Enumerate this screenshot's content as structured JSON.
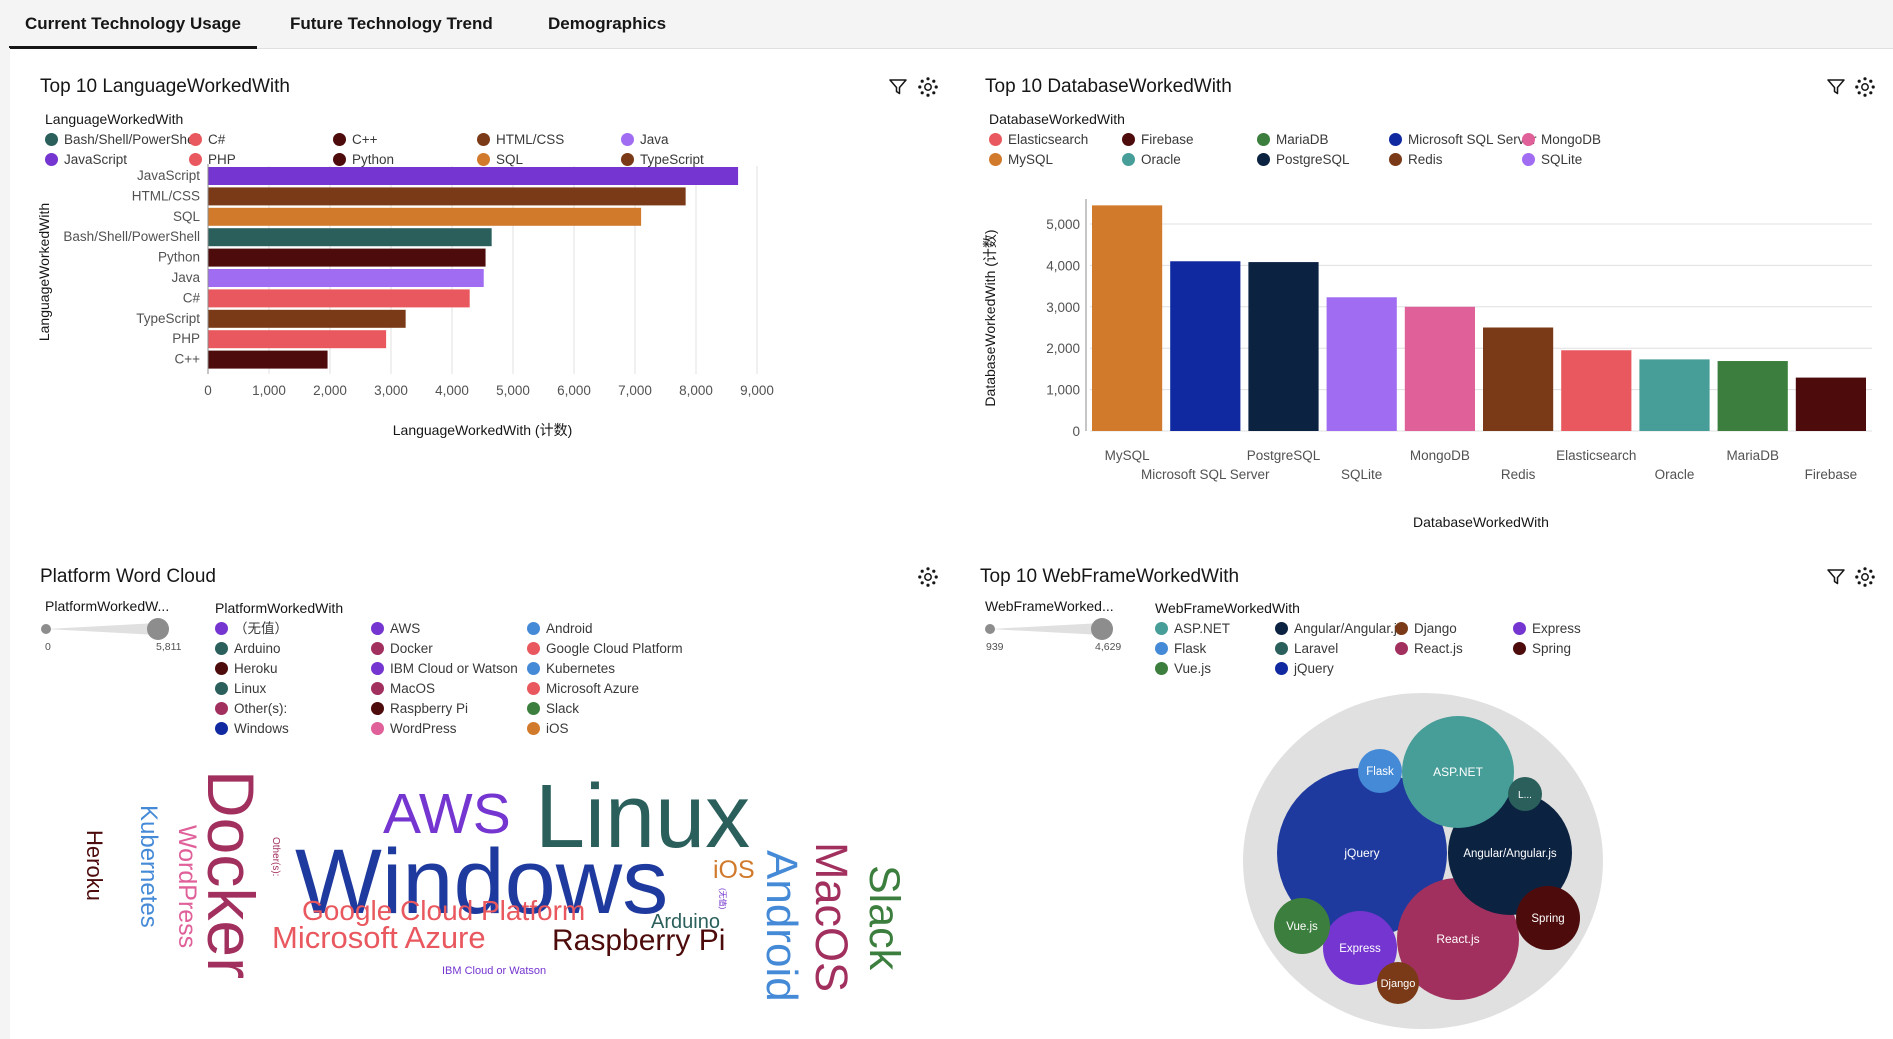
{
  "tabs": [
    {
      "label": "Current Technology Usage",
      "active": true
    },
    {
      "label": "Future Technology Trend",
      "active": false
    },
    {
      "label": "Demographics",
      "active": false
    }
  ],
  "colors": {
    "teal": "#2a5f5b",
    "purple": "#7535d0",
    "brown": "#7b3a17",
    "orange": "#d17a2b",
    "red": "#e8585e",
    "maroon": "#4d0b0b",
    "lilac": "#a06cf2",
    "navy": "#1029a0",
    "darknavy": "#0b2241",
    "pink": "#e0609a",
    "cyan": "#479d98",
    "green": "#3c7e3d",
    "blue": "#458ad7",
    "wine": "#a2305e",
    "sage": "#6a9e8d"
  },
  "language": {
    "title": "Top 10 LanguageWorkedWith",
    "legend_title": "LanguageWorkedWith",
    "legend": [
      {
        "label": "Bash/Shell/PowerShell",
        "color": "#2a5f5b"
      },
      {
        "label": "C#",
        "color": "#e8585e"
      },
      {
        "label": "C++",
        "color": "#4d0b0b"
      },
      {
        "label": "HTML/CSS",
        "color": "#7b3a17"
      },
      {
        "label": "Java",
        "color": "#a06cf2"
      },
      {
        "label": "JavaScript",
        "color": "#7535d0"
      },
      {
        "label": "PHP",
        "color": "#e8585e"
      },
      {
        "label": "Python",
        "color": "#4d0b0b"
      },
      {
        "label": "SQL",
        "color": "#d17a2b"
      },
      {
        "label": "TypeScript",
        "color": "#7b3a17"
      }
    ]
  },
  "database": {
    "title": "Top 10 DatabaseWorkedWith",
    "legend_title": "DatabaseWorkedWith",
    "legend": [
      {
        "label": "Elasticsearch",
        "color": "#e8585e"
      },
      {
        "label": "Firebase",
        "color": "#4d0b0b"
      },
      {
        "label": "MariaDB",
        "color": "#3c7e3d"
      },
      {
        "label": "Microsoft SQL Server",
        "color": "#1029a0"
      },
      {
        "label": "MongoDB",
        "color": "#e0609a"
      },
      {
        "label": "MySQL",
        "color": "#d17a2b"
      },
      {
        "label": "Oracle",
        "color": "#479d98"
      },
      {
        "label": "PostgreSQL",
        "color": "#0b2241"
      },
      {
        "label": "Redis",
        "color": "#7b3a17"
      },
      {
        "label": "SQLite",
        "color": "#a06cf2"
      }
    ]
  },
  "platform": {
    "title": "Platform Word Cloud",
    "slider_label": "PlatformWorkedW...",
    "slider_min": "0",
    "slider_max": "5,811",
    "slider_range": [
      0,
      5811
    ],
    "legend_title": "PlatformWorkedWith",
    "legend": [
      {
        "label": "（无值）",
        "color": "#7535d0"
      },
      {
        "label": "AWS",
        "color": "#7535d0"
      },
      {
        "label": "Android",
        "color": "#458ad7"
      },
      {
        "label": "Arduino",
        "color": "#2a5f5b"
      },
      {
        "label": "Docker",
        "color": "#a2305e"
      },
      {
        "label": "Google Cloud Platform",
        "color": "#e8585e"
      },
      {
        "label": "Heroku",
        "color": "#4d0b0b"
      },
      {
        "label": "IBM Cloud or Watson",
        "color": "#7535d0"
      },
      {
        "label": "Kubernetes",
        "color": "#458ad7"
      },
      {
        "label": "Linux",
        "color": "#2a5f5b"
      },
      {
        "label": "MacOS",
        "color": "#a2305e"
      },
      {
        "label": "Microsoft Azure",
        "color": "#e8585e"
      },
      {
        "label": "Other(s):",
        "color": "#a2305e"
      },
      {
        "label": "Raspberry Pi",
        "color": "#4d0b0b"
      },
      {
        "label": "Slack",
        "color": "#3c7e3d"
      },
      {
        "label": "Windows",
        "color": "#1029a0"
      },
      {
        "label": "WordPress",
        "color": "#e0609a"
      },
      {
        "label": "iOS",
        "color": "#d17a2b"
      }
    ],
    "words": [
      {
        "text": "Windows",
        "color": "#1f3a9e"
      },
      {
        "text": "Linux",
        "color": "#2a5f5b"
      },
      {
        "text": "Docker",
        "color": "#a2305e"
      },
      {
        "text": "AWS",
        "color": "#7535d0"
      },
      {
        "text": "Android",
        "color": "#458ad7"
      },
      {
        "text": "MacOS",
        "color": "#a2305e"
      },
      {
        "text": "Slack",
        "color": "#3c7e3d"
      },
      {
        "text": "Google Cloud Platform",
        "color": "#e8585e"
      },
      {
        "text": "Microsoft Azure",
        "color": "#e8585e"
      },
      {
        "text": "Raspberry Pi",
        "color": "#4d0b0b"
      },
      {
        "text": "Kubernetes",
        "color": "#458ad7"
      },
      {
        "text": "WordPress",
        "color": "#e0609a"
      },
      {
        "text": "Heroku",
        "color": "#4d0b0b"
      },
      {
        "text": "iOS",
        "color": "#d17a2b"
      },
      {
        "text": "Arduino",
        "color": "#2a5f5b"
      },
      {
        "text": "IBM Cloud or Watson",
        "color": "#7535d0"
      },
      {
        "text": "Other(s):",
        "color": "#a2305e"
      },
      {
        "text": "(无值)",
        "color": "#7535d0"
      }
    ]
  },
  "webframe": {
    "title": "Top 10 WebFrameWorkedWith",
    "slider_label": "WebFrameWorked...",
    "slider_min": "939",
    "slider_max": "4,629",
    "slider_range": [
      939,
      4629
    ],
    "legend_title": "WebFrameWorkedWith",
    "legend": [
      {
        "label": "ASP.NET",
        "color": "#479d98"
      },
      {
        "label": "Angular/Angular.js",
        "color": "#0b2241"
      },
      {
        "label": "Django",
        "color": "#7b3a17"
      },
      {
        "label": "Express",
        "color": "#7535d0"
      },
      {
        "label": "Flask",
        "color": "#458ad7"
      },
      {
        "label": "Laravel",
        "color": "#2a5f5b"
      },
      {
        "label": "React.js",
        "color": "#a2305e"
      },
      {
        "label": "Spring",
        "color": "#4d0b0b"
      },
      {
        "label": "Vue.js",
        "color": "#3c7e3d"
      },
      {
        "label": "jQuery",
        "color": "#1029a0"
      }
    ],
    "bubbles": [
      {
        "label": "jQuery",
        "color": "#1f3a9e"
      },
      {
        "label": "React.js",
        "color": "#a2305e"
      },
      {
        "label": "Angular/Angular.js",
        "color": "#0b2241"
      },
      {
        "label": "ASP.NET",
        "color": "#479d98"
      },
      {
        "label": "Express",
        "color": "#7535d0"
      },
      {
        "label": "Spring",
        "color": "#4d0b0b"
      },
      {
        "label": "Vue.js",
        "color": "#3c7e3d"
      },
      {
        "label": "Flask",
        "color": "#458ad7"
      },
      {
        "label": "Django",
        "color": "#7b3a17"
      },
      {
        "label": "L...",
        "color": "#2a5f5b"
      }
    ]
  },
  "chart_data": [
    {
      "type": "bar",
      "orientation": "horizontal",
      "categories": [
        "JavaScript",
        "HTML/CSS",
        "SQL",
        "Bash/Shell/PowerShell",
        "Python",
        "Java",
        "C#",
        "TypeScript",
        "PHP",
        "C++"
      ],
      "values": [
        8690,
        7830,
        7100,
        4650,
        4550,
        4520,
        4290,
        3240,
        2920,
        1960
      ],
      "colors": [
        "#7535d0",
        "#7b3a17",
        "#d17a2b",
        "#2a5f5b",
        "#4d0b0b",
        "#a06cf2",
        "#e8585e",
        "#7b3a17",
        "#e8585e",
        "#4d0b0b"
      ],
      "xlabel": "LanguageWorkedWith (计数)",
      "ylabel": "LanguageWorkedWith",
      "xticks": [
        "0",
        "1,000",
        "2,000",
        "3,000",
        "4,000",
        "5,000",
        "6,000",
        "7,000",
        "8,000",
        "9,000"
      ],
      "xlim": [
        0,
        9000
      ],
      "grid": true
    },
    {
      "type": "bar",
      "categories": [
        "MySQL",
        "Microsoft SQL Server",
        "PostgreSQL",
        "SQLite",
        "MongoDB",
        "Redis",
        "Elasticsearch",
        "Oracle",
        "MariaDB",
        "Firebase"
      ],
      "values": [
        5450,
        4100,
        4080,
        3230,
        3000,
        2500,
        1950,
        1730,
        1690,
        1290
      ],
      "colors": [
        "#d17a2b",
        "#1029a0",
        "#0b2241",
        "#a06cf2",
        "#e0609a",
        "#7b3a17",
        "#e8585e",
        "#479d98",
        "#3c7e3d",
        "#4d0b0b"
      ],
      "xlabel": "DatabaseWorkedWith",
      "ylabel": "DatabaseWorkedWith (计数)",
      "yticks": [
        "0",
        "1,000",
        "2,000",
        "3,000",
        "4,000",
        "5,000"
      ],
      "ylim": [
        0,
        5500
      ],
      "grid": true
    }
  ]
}
